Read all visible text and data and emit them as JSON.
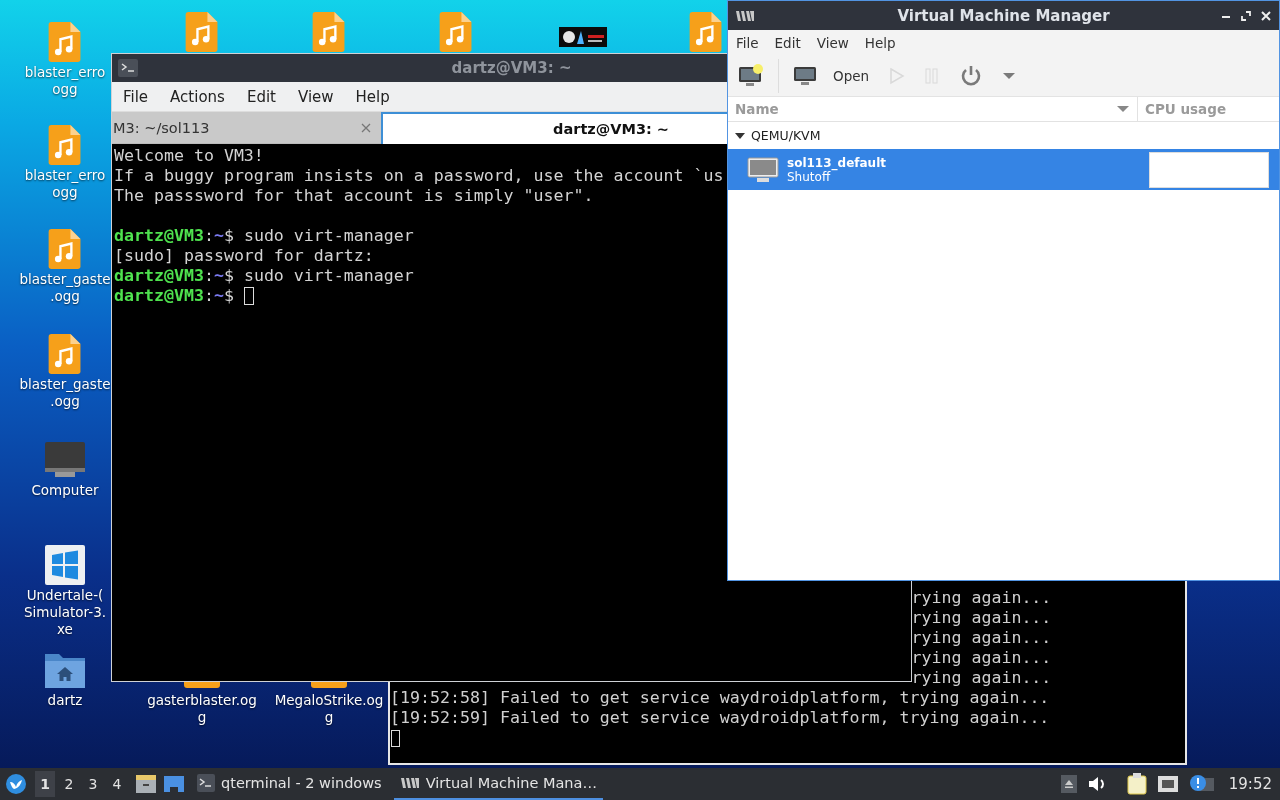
{
  "desktop_icons": [
    {
      "kind": "audio",
      "label": [
        "blaster_erro",
        "ogg"
      ]
    },
    {
      "kind": "audio",
      "label": [
        "blaster_erro",
        "ogg"
      ]
    },
    {
      "kind": "audio",
      "label": [
        "blaster_gaste",
        ".ogg"
      ]
    },
    {
      "kind": "audio",
      "label": [
        "blaster_gaste",
        ".ogg"
      ]
    },
    {
      "kind": "computer",
      "label": [
        "Computer"
      ]
    },
    {
      "kind": "exe",
      "label": [
        "Undertale-(",
        "Simulator-3.",
        "xe"
      ]
    },
    {
      "kind": "folder",
      "label": [
        "dartz"
      ]
    },
    {
      "kind": "audio"
    },
    {
      "kind": "audio"
    },
    {
      "kind": "audio"
    },
    {
      "kind": "thumbnail"
    },
    {
      "kind": "audio"
    },
    {
      "kind": "audio_edge",
      "label": [
        "gasterblaster.og",
        "g"
      ]
    },
    {
      "kind": "audio_edge",
      "label": [
        "MegaloStrike.og",
        "g"
      ]
    }
  ],
  "terminal_back": {
    "lines": [
      {
        "kind": "cut",
        "text": "rying again..."
      },
      {
        "kind": "cut",
        "text": "rying again..."
      },
      {
        "kind": "cut",
        "text": "rying again..."
      },
      {
        "kind": "cut",
        "text": "rying again..."
      },
      {
        "kind": "cut",
        "text": "rying again..."
      },
      {
        "kind": "full",
        "text": "[19:52:58] Failed to get service waydroidplatform, trying again..."
      },
      {
        "kind": "full",
        "text": "[19:52:59] Failed to get service waydroidplatform, trying again..."
      },
      {
        "kind": "cursor"
      }
    ]
  },
  "terminal": {
    "title": "dartz@VM3: ~",
    "menu": [
      "File",
      "Actions",
      "Edit",
      "View",
      "Help"
    ],
    "tabs": [
      {
        "label": "M3: ~/sol113",
        "selected": false
      },
      {
        "label": "dartz@VM3: ~",
        "selected": true
      }
    ],
    "lines": [
      {
        "kind": "text",
        "text": "Welcome to VM3!"
      },
      {
        "kind": "text",
        "text": "If a buggy program insists on a password, use the account `us"
      },
      {
        "kind": "text",
        "text": "The passsword for that account is simply \"user\"."
      },
      {
        "kind": "blank"
      },
      {
        "kind": "prompt",
        "user": "dartz@VM3",
        "sep": ":",
        "path": "~",
        "rest": "$ sudo virt-manager",
        "cursor": false
      },
      {
        "kind": "text",
        "text": "[sudo] password for dartz:"
      },
      {
        "kind": "prompt",
        "user": "dartz@VM3",
        "sep": ":",
        "path": "~",
        "rest": "$ sudo virt-manager",
        "cursor": false
      },
      {
        "kind": "prompt",
        "user": "dartz@VM3",
        "sep": ":",
        "path": "~",
        "rest": "$ ",
        "cursor": true
      }
    ]
  },
  "vmm": {
    "title": "Virtual Machine Manager",
    "menu": [
      "File",
      "Edit",
      "View",
      "Help"
    ],
    "toolbar": [
      {
        "kind": "new",
        "disabled": false
      },
      {
        "kind": "open",
        "label": "Open",
        "disabled": false
      },
      {
        "kind": "run",
        "disabled": true
      },
      {
        "kind": "pause",
        "disabled": true
      },
      {
        "kind": "shutdown",
        "disabled": false
      },
      {
        "kind": "dropdown",
        "disabled": false
      }
    ],
    "columns": [
      "Name",
      "CPU usage"
    ],
    "groups": [
      {
        "name": "QEMU/KVM",
        "expanded": true,
        "vms": [
          {
            "name": "sol113_default",
            "status": "Shutoff",
            "selected": true
          }
        ]
      }
    ]
  },
  "taskbar": {
    "workspaces": [
      {
        "label": "1",
        "selected": true
      },
      {
        "label": "2",
        "selected": false
      },
      {
        "label": "3",
        "selected": false
      },
      {
        "label": "4",
        "selected": false
      }
    ],
    "tasks": [
      {
        "kind": "terminal",
        "label": "qterminal - 2 windows",
        "selected": false
      },
      {
        "kind": "vmm",
        "label": "Virtual Machine Mana…",
        "selected": true
      }
    ],
    "clock": "19:52"
  }
}
